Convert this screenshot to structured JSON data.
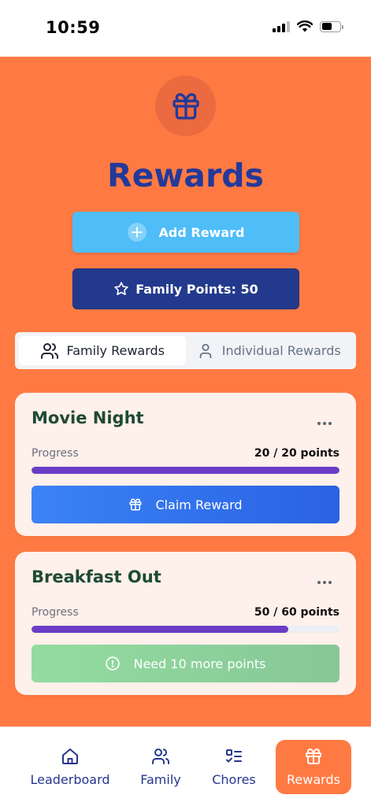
{
  "status": {
    "time": "10:59"
  },
  "header": {
    "title": "Rewards",
    "icon": "gift-icon"
  },
  "actions": {
    "add_reward": "Add Reward",
    "family_points": "Family Points: 50"
  },
  "tabs": [
    {
      "label": "Family Rewards",
      "icon": "users-icon",
      "active": true
    },
    {
      "label": "Individual Rewards",
      "icon": "user-icon",
      "active": false
    }
  ],
  "rewards": [
    {
      "title": "Movie Night",
      "progress_label": "Progress",
      "progress_text": "20 / 20 points",
      "current": 20,
      "goal": 20,
      "action_label": "Claim Reward",
      "action_icon": "gift-icon"
    },
    {
      "title": "Breakfast Out",
      "progress_label": "Progress",
      "progress_text": "50 / 60 points",
      "current": 50,
      "goal": 60,
      "action_label": "Need 10 more points",
      "action_icon": "alert-circle-icon"
    }
  ],
  "nav": [
    {
      "label": "Leaderboard",
      "icon": "home-icon",
      "active": false
    },
    {
      "label": "Family",
      "icon": "users-icon",
      "active": false
    },
    {
      "label": "Chores",
      "icon": "checklist-icon",
      "active": false
    },
    {
      "label": "Rewards",
      "icon": "gift-icon",
      "active": true
    }
  ],
  "colors": {
    "background": "#FF7A43",
    "title": "#23399A",
    "add_button": "#4FBDF8",
    "points_box": "#233A8C",
    "card": "#FEF0EA",
    "progress_fill": "#6A3DC5",
    "claim_button": "#3B83F6",
    "need_button": "#93DCA0"
  }
}
